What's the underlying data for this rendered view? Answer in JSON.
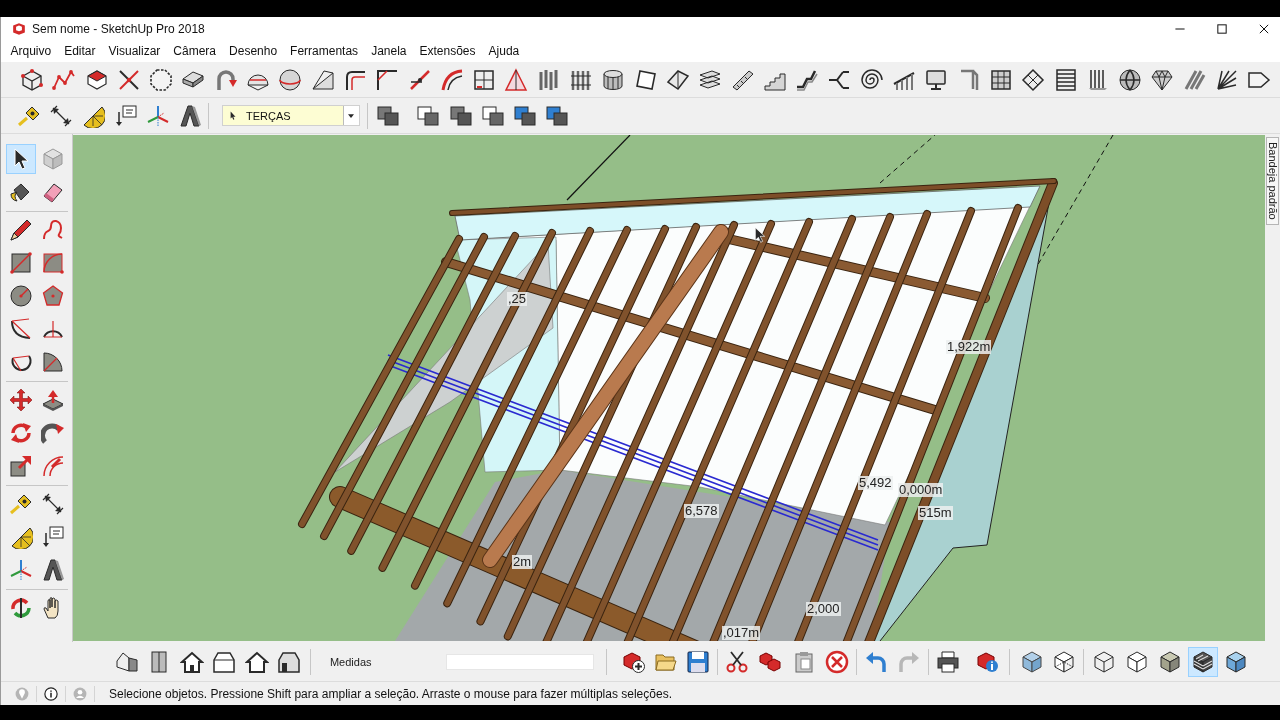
{
  "window": {
    "title": "Sem nome - SketchUp Pro 2018"
  },
  "menu": [
    "Arquivo",
    "Editar",
    "Visualizar",
    "Câmera",
    "Desenho",
    "Ferramentas",
    "Janela",
    "Extensões",
    "Ajuda"
  ],
  "extension_toolbar": {
    "tools": [
      {
        "kind": "cube-points"
      },
      {
        "kind": "polyline"
      },
      {
        "kind": "block"
      },
      {
        "kind": "crossed-lines"
      },
      {
        "kind": "octagon"
      },
      {
        "kind": "plate"
      },
      {
        "kind": "curved-arrow"
      },
      {
        "kind": "dome"
      },
      {
        "kind": "sphere"
      },
      {
        "kind": "wedge"
      },
      {
        "kind": "corner-round"
      },
      {
        "kind": "corner-angle"
      },
      {
        "kind": "line"
      },
      {
        "kind": "curve"
      },
      {
        "kind": "window"
      },
      {
        "kind": "triangle"
      },
      {
        "kind": "columns"
      },
      {
        "kind": "fence"
      },
      {
        "kind": "cylinder"
      },
      {
        "kind": "panel"
      },
      {
        "kind": "tile"
      },
      {
        "kind": "slabs"
      },
      {
        "kind": "ramp"
      },
      {
        "kind": "stairs"
      },
      {
        "kind": "zigzag"
      },
      {
        "kind": "branch"
      },
      {
        "kind": "spiral"
      },
      {
        "kind": "railing"
      },
      {
        "kind": "monitor"
      },
      {
        "kind": "bracket"
      },
      {
        "kind": "grid"
      },
      {
        "kind": "hatch"
      },
      {
        "kind": "louver"
      },
      {
        "kind": "bars"
      },
      {
        "kind": "sphere-grid"
      },
      {
        "kind": "gem"
      },
      {
        "kind": "slats"
      },
      {
        "kind": "fan"
      },
      {
        "kind": "arrow-shape"
      }
    ]
  },
  "construction_toolbar": {
    "tools": [
      {
        "kind": "tape-measure"
      },
      {
        "kind": "dimension"
      },
      {
        "kind": "protractor"
      },
      {
        "kind": "text-label"
      },
      {
        "kind": "axes"
      },
      {
        "kind": "extrude"
      }
    ]
  },
  "layers_toolbar": {
    "current_layer": "TERÇAS",
    "tools": [
      {
        "kind": "layers"
      },
      {
        "kind": "layers-outline"
      },
      {
        "kind": "layers"
      },
      {
        "kind": "layers-outline"
      },
      {
        "kind": "layers-tinted"
      },
      {
        "kind": "layers-tinted"
      }
    ]
  },
  "tool_palette": {
    "groups": [
      {
        "tools": [
          {
            "kind": "select",
            "selected": true
          },
          {
            "kind": "component",
            "selected": false
          },
          {
            "kind": "paint-bucket",
            "selected": false
          },
          {
            "kind": "eraser",
            "selected": false
          }
        ]
      },
      {
        "tools": [
          {
            "kind": "pencil",
            "selected": false
          },
          {
            "kind": "freehand",
            "selected": false
          },
          {
            "kind": "rectangle",
            "selected": false
          },
          {
            "kind": "rotated-rectangle",
            "selected": false
          },
          {
            "kind": "circle",
            "selected": false
          },
          {
            "kind": "polygon",
            "selected": false
          },
          {
            "kind": "arc",
            "selected": false
          },
          {
            "kind": "two-point-arc",
            "selected": false
          },
          {
            "kind": "three-point-arc",
            "selected": false
          },
          {
            "kind": "pie",
            "selected": false
          }
        ]
      },
      {
        "tools": [
          {
            "kind": "move",
            "selected": false
          },
          {
            "kind": "push-pull",
            "selected": false
          },
          {
            "kind": "rotate",
            "selected": false
          },
          {
            "kind": "follow-me",
            "selected": false
          },
          {
            "kind": "scale",
            "selected": false
          },
          {
            "kind": "offset",
            "selected": false
          }
        ]
      },
      {
        "tools": [
          {
            "kind": "tape-measure",
            "selected": false
          },
          {
            "kind": "dimension",
            "selected": false
          },
          {
            "kind": "protractor",
            "selected": false
          },
          {
            "kind": "text-label",
            "selected": false
          },
          {
            "kind": "axes",
            "selected": false
          },
          {
            "kind": "extrude",
            "selected": false
          }
        ]
      },
      {
        "tools": [
          {
            "kind": "orbit",
            "selected": false
          },
          {
            "kind": "pan",
            "selected": false
          }
        ]
      }
    ]
  },
  "viewport": {
    "dimension_labels": [
      "1,922m",
      "5,492",
      "0,000m",
      "515m",
      "6,578",
      "2,000",
      ",017m",
      "2m",
      ",25"
    ]
  },
  "tray": {
    "tab": "Bandeja padrão"
  },
  "bottom_toolbar": {
    "views": [
      {
        "kind": "iso"
      },
      {
        "kind": "top"
      },
      {
        "kind": "front"
      },
      {
        "kind": "right"
      },
      {
        "kind": "back"
      },
      {
        "kind": "left"
      }
    ],
    "measurements": {
      "label": "Medidas"
    },
    "edit_groups": [
      {
        "tools": [
          {
            "kind": "new",
            "disabled": false
          },
          {
            "kind": "open",
            "disabled": false
          },
          {
            "kind": "save",
            "disabled": false
          }
        ]
      },
      {
        "tools": [
          {
            "kind": "cut",
            "disabled": false
          },
          {
            "kind": "copy",
            "disabled": false
          },
          {
            "kind": "paste",
            "disabled": false
          },
          {
            "kind": "delete",
            "disabled": false
          }
        ]
      },
      {
        "tools": [
          {
            "kind": "undo",
            "disabled": false
          },
          {
            "kind": "redo",
            "disabled": true
          }
        ]
      },
      {
        "tools": [
          {
            "kind": "print",
            "disabled": false
          },
          {
            "kind": "model-info",
            "disabled": false
          }
        ]
      }
    ],
    "style_groups": [
      {
        "tools": [
          {
            "kind": "xray",
            "selected": false
          },
          {
            "kind": "back-edges",
            "selected": false
          }
        ]
      },
      {
        "tools": [
          {
            "kind": "wireframe",
            "selected": false
          },
          {
            "kind": "hidden-line",
            "selected": false
          },
          {
            "kind": "shaded",
            "selected": false
          },
          {
            "kind": "textured",
            "selected": true
          },
          {
            "kind": "monochrome",
            "selected": false
          }
        ]
      }
    ]
  },
  "status_bar": {
    "message": "Selecione objetos. Pressione Shift para ampliar a seleção. Arraste o mouse para fazer múltiplas seleções."
  }
}
